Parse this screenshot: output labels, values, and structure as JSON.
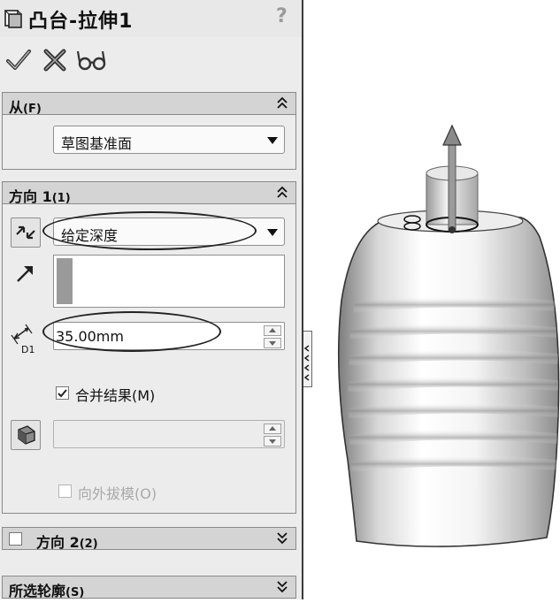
{
  "feature": {
    "title": "凸台-拉伸1",
    "help_label": "?"
  },
  "actions": [
    {
      "name": "ok",
      "icon": "checkmark-icon"
    },
    {
      "name": "cancel",
      "icon": "cross-icon"
    },
    {
      "name": "preview",
      "icon": "glasses-icon"
    }
  ],
  "from_section": {
    "title": "从",
    "shortcut": "(F)",
    "start_condition": "草图基准面"
  },
  "direction1": {
    "title": "方向 1",
    "shortcut": "(1)",
    "end_condition": "给定深度",
    "depth_icon_label": "D1",
    "depth_value": "35.00mm",
    "merge_label": "合并结果(M)",
    "merge_checked": true,
    "draft_label": "向外拔模(O)",
    "draft_checked": false
  },
  "direction2": {
    "title": "方向 2",
    "shortcut": "(2)",
    "checked": false
  },
  "contours": {
    "title": "所选轮廓",
    "shortcut": "(S)"
  },
  "colors": {
    "panel_bg": "#ececec",
    "header_bg": "#d4d4d4",
    "selection_bar": "#9a9a9a"
  }
}
